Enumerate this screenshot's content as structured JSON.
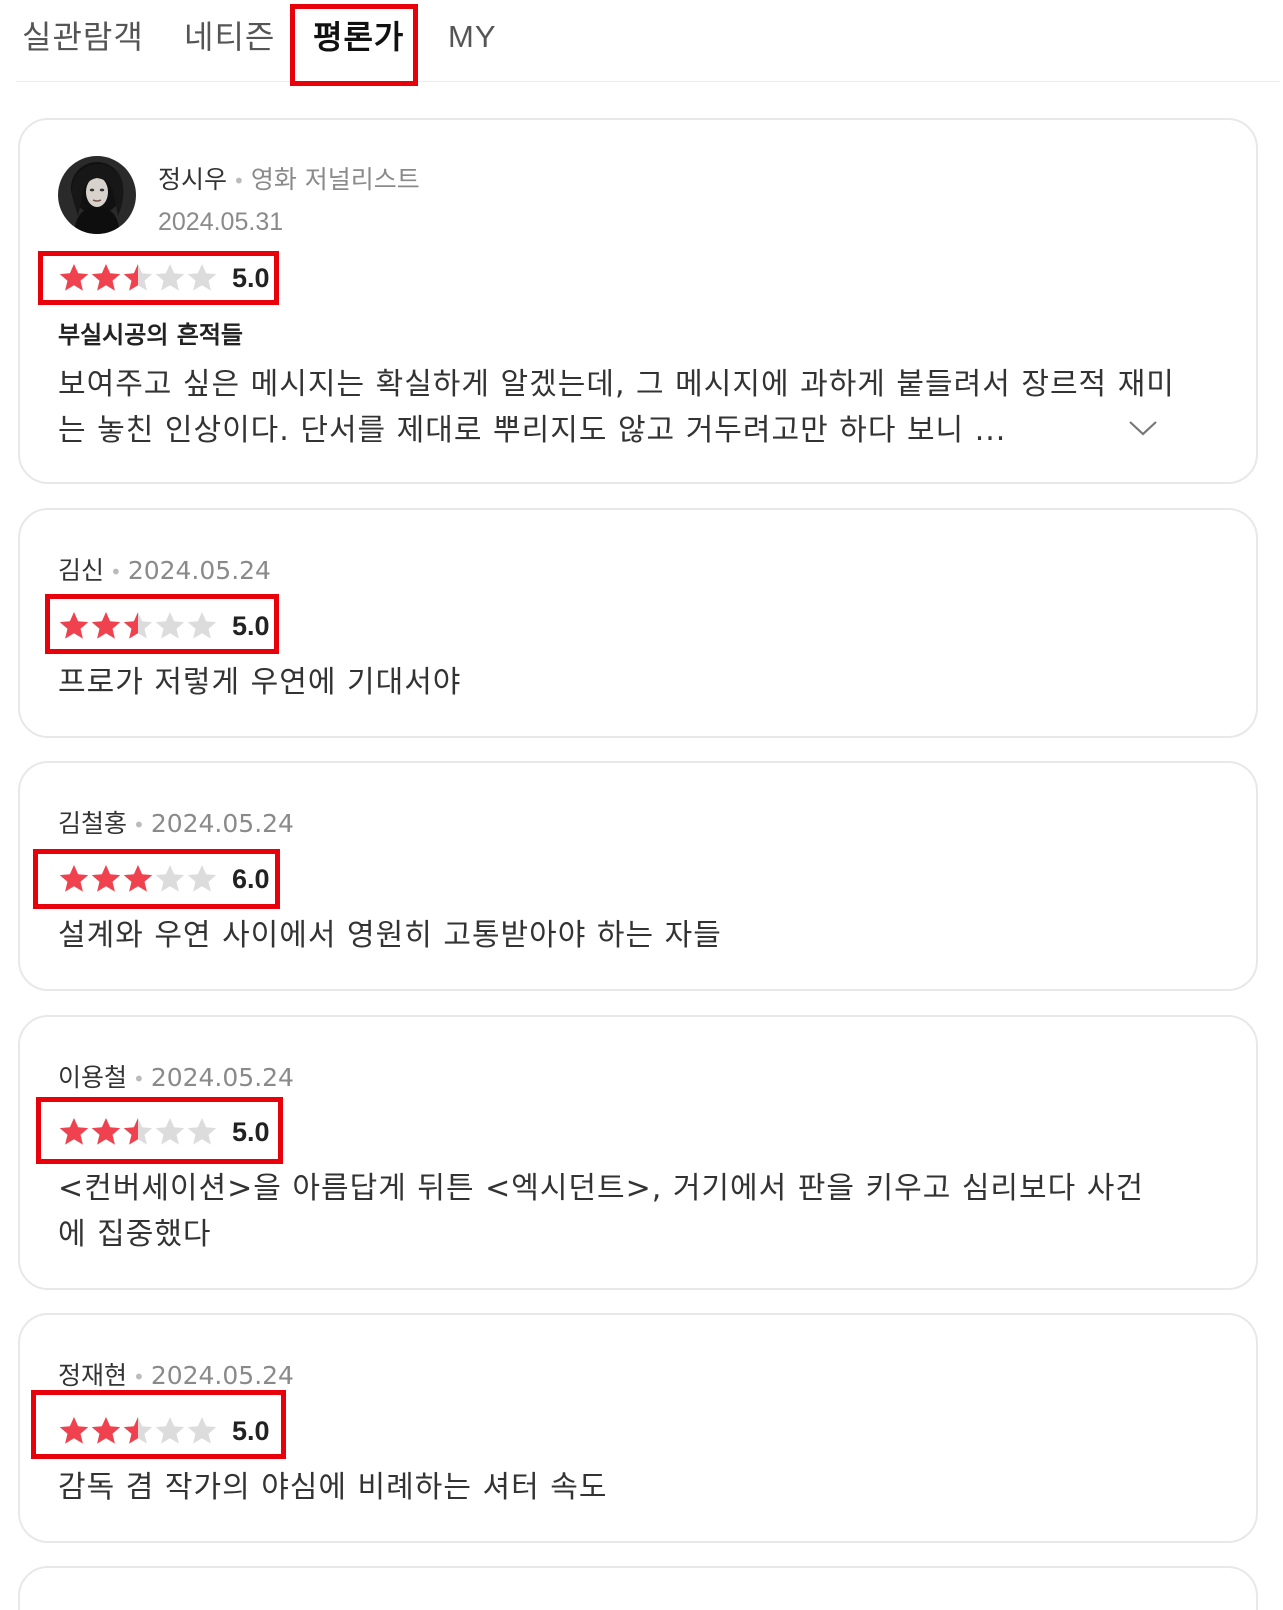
{
  "tabs": [
    "실관람객",
    "네티즌",
    "평론가",
    "MY"
  ],
  "active_tab": "평론가",
  "colors": {
    "star_on": "#f0414e",
    "star_off": "#dcdcdc",
    "highlight": "#e8000b"
  },
  "reviews": [
    {
      "author": "정시우",
      "role": "영화 저널리스트",
      "date": "2024.05.31",
      "rating": 5.0,
      "rating_label": "5.0",
      "title": "부실시공의 흔적들",
      "text": "보여주고 싶은 메시지는 확실하게 알겠는데, 그 메시지에 과하게 붙들려서 장르적 재미는 놓친 인상이다. 단서를 제대로 뿌리지도 않고 거두려고만 하다 보니 ...",
      "more_icon": "chevron-down-icon"
    },
    {
      "author": "김신",
      "date": "2024.05.24",
      "rating": 5.0,
      "rating_label": "5.0",
      "text": "프로가 저렇게 우연에 기대서야"
    },
    {
      "author": "김철홍",
      "date": "2024.05.24",
      "rating": 6.0,
      "rating_label": "6.0",
      "text": "설계와 우연 사이에서 영원히 고통받아야 하는 자들"
    },
    {
      "author": "이용철",
      "date": "2024.05.24",
      "rating": 5.0,
      "rating_label": "5.0",
      "text": "<컨버세이션>을 아름답게 뒤튼 <엑시던트>, 거기에서 판을 키우고 심리보다 사건에 집중했다"
    },
    {
      "author": "정재현",
      "date": "2024.05.24",
      "rating": 5.0,
      "rating_label": "5.0",
      "text": "감독 겸 작가의 야심에 비례하는 셔터 속도"
    }
  ]
}
